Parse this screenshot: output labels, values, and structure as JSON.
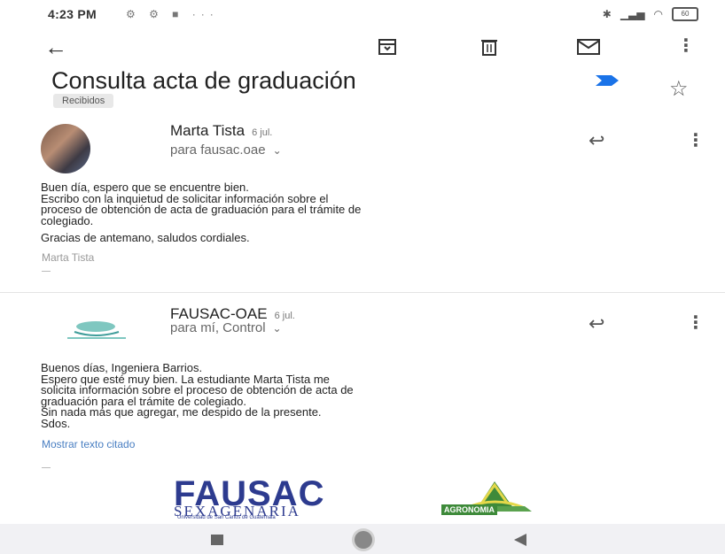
{
  "status_bar": {
    "time": "4:23 PM",
    "left_icons": "⚙ ⚙ ■ ···",
    "battery": "60"
  },
  "toolbar": {
    "back_icon": "←",
    "archive_icon": "archive-icon",
    "delete_icon": "trash-icon",
    "mark_unread_icon": "mail-icon",
    "more_icon": "⋮"
  },
  "email": {
    "subject": "Consulta acta de graduación",
    "label": "Recibidos",
    "star_icon": "☆",
    "importance_color": "#1a73e8"
  },
  "messages": [
    {
      "sender": "Marta Tista",
      "date": "6 jul.",
      "recipient": "para fausac.oae",
      "body": [
        "Buen día, espero que se encuentre bien.",
        "Escribo con la inquietud de solicitar información sobre el",
        "proceso de obtención de acta de graduación para el trámite de",
        "colegiado."
      ],
      "closing": "Gracias de antemano, saludos cordiales.",
      "signature": "Marta Tista"
    },
    {
      "sender": "FAUSAC-OAE",
      "date": "6 jul.",
      "recipient": "para mí, Control",
      "body": [
        "Buenos días, Ingeniera Barrios.",
        "Espero que esté muy bien.  La estudiante Marta Tista me",
        "solicita información  sobre el proceso de obtención de acta de",
        "graduación para el trámite de colegiado.",
        "Sin nada más que agregar, me despido de la presente.",
        "Sdos."
      ],
      "quoted_link": "Mostrar texto citado"
    }
  ],
  "footer_logo": {
    "name": "FAUSAC",
    "sub": "SEXAGENARIA",
    "small": "Universidad de San Carlos de Guatemala",
    "agro": "AGRONOMIA"
  },
  "nav": {
    "recents": "recents-icon",
    "home": "home-icon",
    "back": "back-icon"
  }
}
